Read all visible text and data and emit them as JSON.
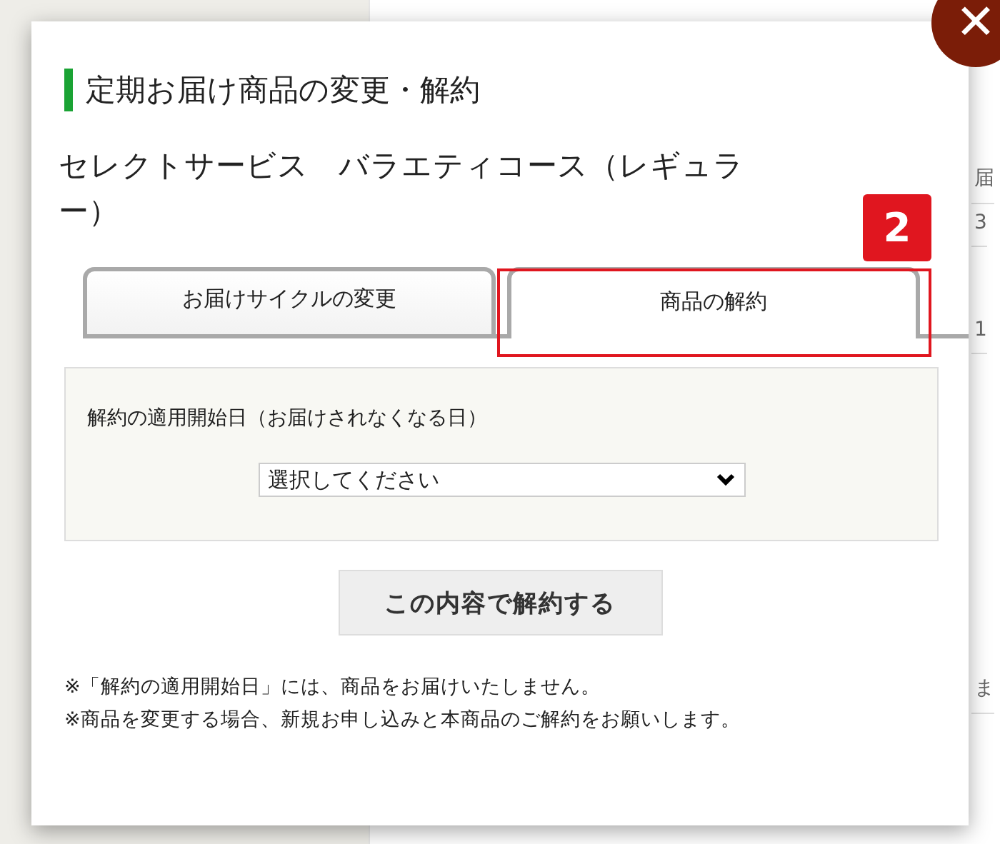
{
  "background_page": {
    "fragments": [
      "届",
      "3",
      "1",
      "ま"
    ]
  },
  "dialog": {
    "close_label": "✕",
    "heading": "定期お届け商品の変更・解約",
    "subtitle": "セレクトサービス　バラエティコース（レギュラー）",
    "tabs": [
      {
        "label": "お届けサイクルの変更",
        "selected": false
      },
      {
        "label": "商品の解約",
        "selected": true
      }
    ],
    "form": {
      "label": "解約の適用開始日（お届けされなくなる日）",
      "select_value": "選択してください"
    },
    "submit_button": "この内容で解約する",
    "notes": [
      "※「解約の適用開始日」には、商品をお届けいたしません。",
      "※商品を変更する場合、新規お申し込みと本商品のご解約をお願いします。"
    ]
  },
  "annotation": {
    "label": "2"
  }
}
